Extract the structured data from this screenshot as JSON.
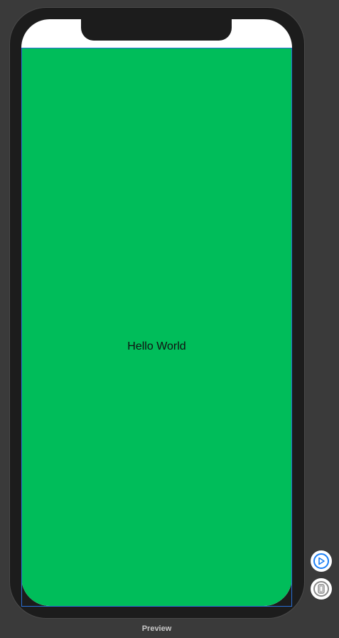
{
  "canvas": {
    "background_color": "#3a3a3a"
  },
  "device": {
    "frame_color": "#1c1c1c",
    "screen": {
      "status_area_color": "#ffffff",
      "content_background_color": "#00bd5a",
      "text": "Hello World",
      "text_color": "#111111",
      "selection_outline_color": "#2a6fd6"
    }
  },
  "controls": {
    "live_preview_icon": "play-circle-icon",
    "live_preview_color": "#1b7ff5",
    "device_preview_icon": "device-icon",
    "device_preview_color": "#8a8a8a"
  },
  "footer": {
    "label": "Preview"
  }
}
